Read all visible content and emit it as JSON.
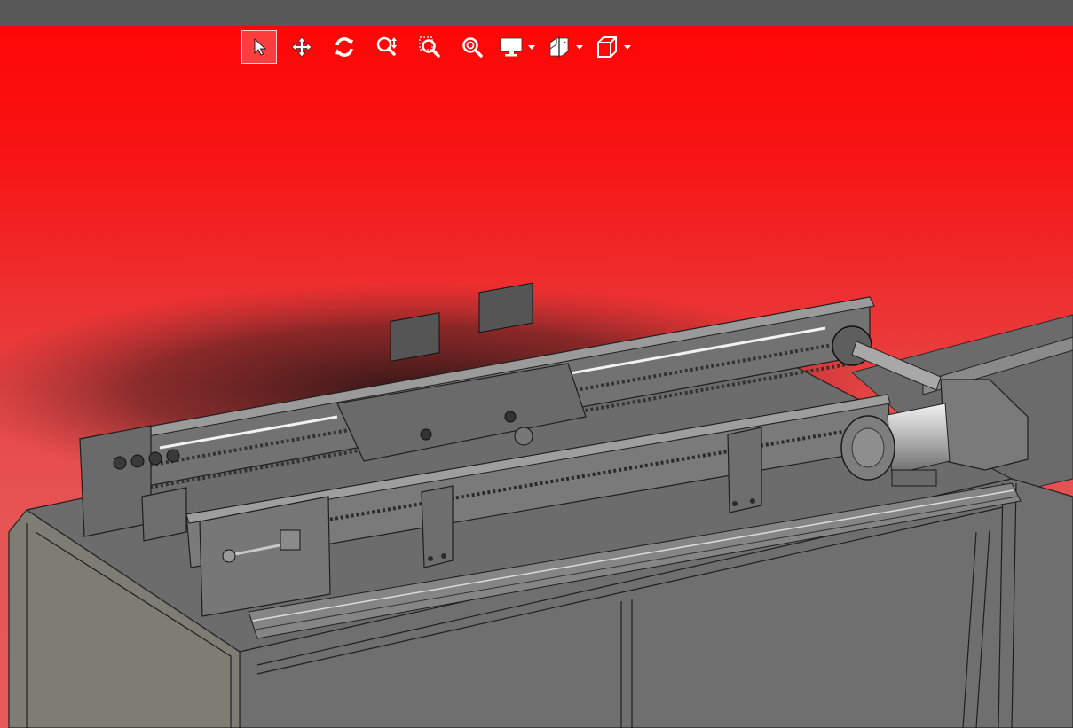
{
  "toolbar": {
    "tools": [
      {
        "icon": "select-arrow-icon",
        "active": true
      },
      {
        "icon": "pan-move-icon",
        "active": false
      },
      {
        "icon": "rotate-view-icon",
        "active": false
      },
      {
        "icon": "zoom-in-out-icon",
        "active": false
      },
      {
        "icon": "zoom-window-icon",
        "active": false
      },
      {
        "icon": "zoom-to-fit-icon",
        "active": false
      },
      {
        "icon": "display-style-icon",
        "dropdown": true
      },
      {
        "icon": "section-view-icon",
        "dropdown": true
      },
      {
        "icon": "standard-views-cube-icon",
        "dropdown": true
      }
    ]
  },
  "viewport": {
    "background_top": "#ff0606",
    "background_bottom": "#e85a5a",
    "model_color": "#6e6e6e"
  },
  "model": {
    "type": "conveyor assembly",
    "components": [
      "machine-frame",
      "chain-conveyor-rail",
      "linear-rail",
      "servo-motor",
      "pneumatic-cylinder",
      "carriage-plates"
    ]
  }
}
